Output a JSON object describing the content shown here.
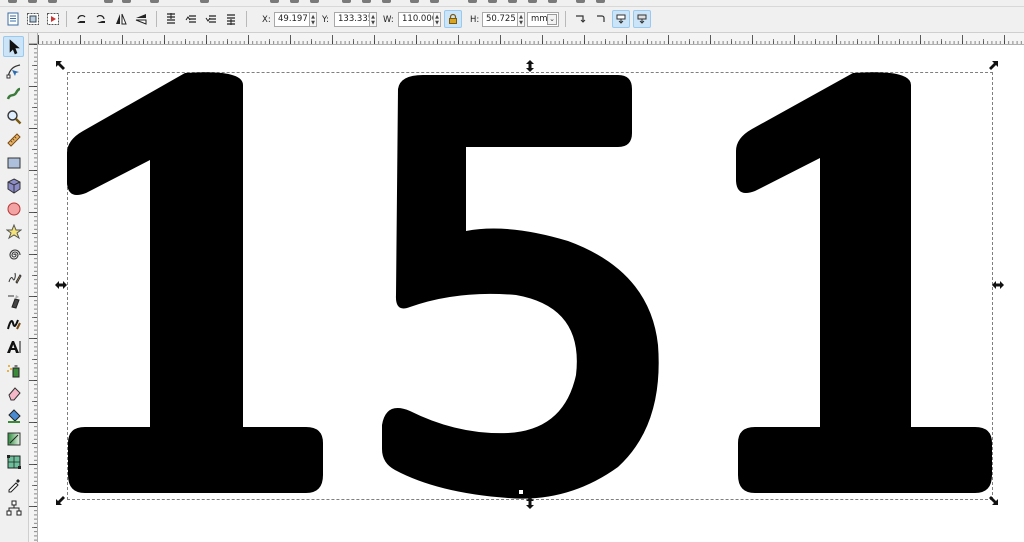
{
  "tool_controls": {
    "x_label": "X:",
    "x_value": "49.197",
    "y_label": "Y:",
    "y_value": "133.335",
    "w_label": "W:",
    "w_value": "110.000",
    "h_label": "H:",
    "h_value": "50.725",
    "unit": "mm",
    "lock_icon": "lock-icon",
    "accent": "#cce4f7"
  },
  "canvas": {
    "text": "151",
    "text_color": "#000000",
    "background": "#ffffff"
  },
  "toolbox": {
    "tools": [
      "selector",
      "node",
      "tweak",
      "zoom",
      "measure",
      "rectangle",
      "3d-box",
      "ellipse",
      "star",
      "spiral",
      "pencil",
      "pen",
      "calligraphy",
      "text",
      "spray",
      "eraser",
      "paint-bucket",
      "gradient",
      "mesh",
      "dropper",
      "connector"
    ],
    "active": "selector"
  }
}
